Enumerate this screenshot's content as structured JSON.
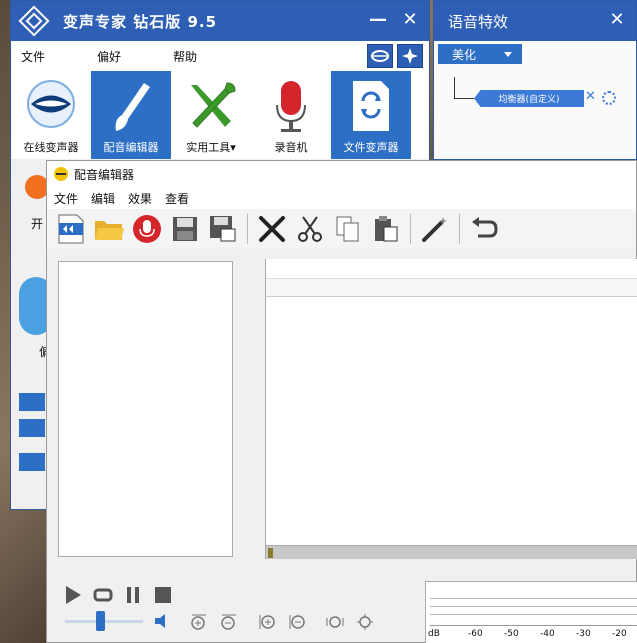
{
  "main_window": {
    "title": "变声专家  钻石版  9.5",
    "menu": [
      "文件",
      "偏好",
      "帮助"
    ],
    "tools": [
      {
        "label": "在线变声器",
        "icon": "lips-globe-icon"
      },
      {
        "label": "配音编辑器",
        "icon": "paintbrush-icon",
        "active": true
      },
      {
        "label": "实用工具▾",
        "icon": "wrench-screwdriver-icon"
      },
      {
        "label": "录音机",
        "icon": "microphone-icon"
      },
      {
        "label": "文件变声器",
        "icon": "file-convert-icon",
        "active": true
      }
    ],
    "behind_labels": [
      "开",
      "偏"
    ]
  },
  "effects_window": {
    "title": "语音特效",
    "select_value": "美化",
    "effect_chip": "均衡器(自定义)"
  },
  "editor_window": {
    "title": "配音编辑器",
    "menu": [
      "文件",
      "编辑",
      "效果",
      "查看"
    ]
  },
  "meter": {
    "scale": [
      "dB",
      "-60",
      "-50",
      "-40",
      "-30",
      "-20"
    ]
  },
  "volume_level": 0.45,
  "colors": {
    "title_blue": "#2e5fb5",
    "accent_blue": "#2e6fc6",
    "record_red": "#d4262a",
    "tool_green": "#3b9a2a"
  }
}
